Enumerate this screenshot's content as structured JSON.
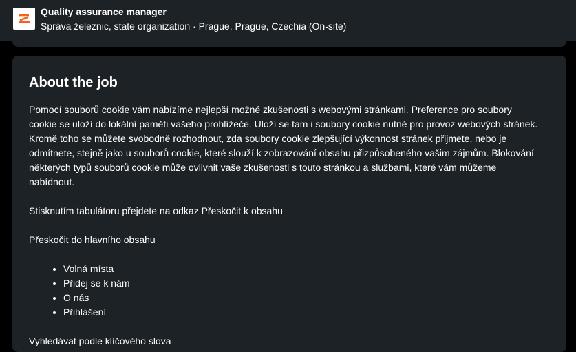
{
  "header": {
    "job_title": "Quality assurance manager",
    "subtitle": "Správa železnic, state organization · Prague, Prague, Czechia (On-site)",
    "logo_icon": "company-logo-icon",
    "logo_color": "#f0641e"
  },
  "about": {
    "heading": "About the job",
    "paragraph_1": "Pomocí souborů cookie vám nabízíme nejlepší možné zkušenosti s webovými stránkami. Preference pro soubory cookie se uloží do lokální paměti vašeho prohlížeče. Uloží se tam i soubory cookie nutné pro provoz webových stránek. Kromě toho se můžete svobodně rozhodnout, zda soubory cookie zlepšující výkonnost stránek přijmete, nebo je odmítnete, stejně jako u souborů cookie, které slouží k zobrazování obsahu přizpůsobeného vašim zájmům. Blokování některých typů souborů cookie může ovlivnit vaše zkušenosti s touto stránkou a službami, které vám můžeme nabídnout.",
    "paragraph_2": "Stisknutím tabulátoru přejdete na odkaz Přeskočit k obsahu",
    "paragraph_3": "Přeskočit do hlavního obsahu",
    "list_items": [
      "Volná místa",
      "Přidej se k nám",
      "O nás",
      "Přihlášení"
    ],
    "paragraph_4": "Vyhledávat podle klíčového slova"
  }
}
